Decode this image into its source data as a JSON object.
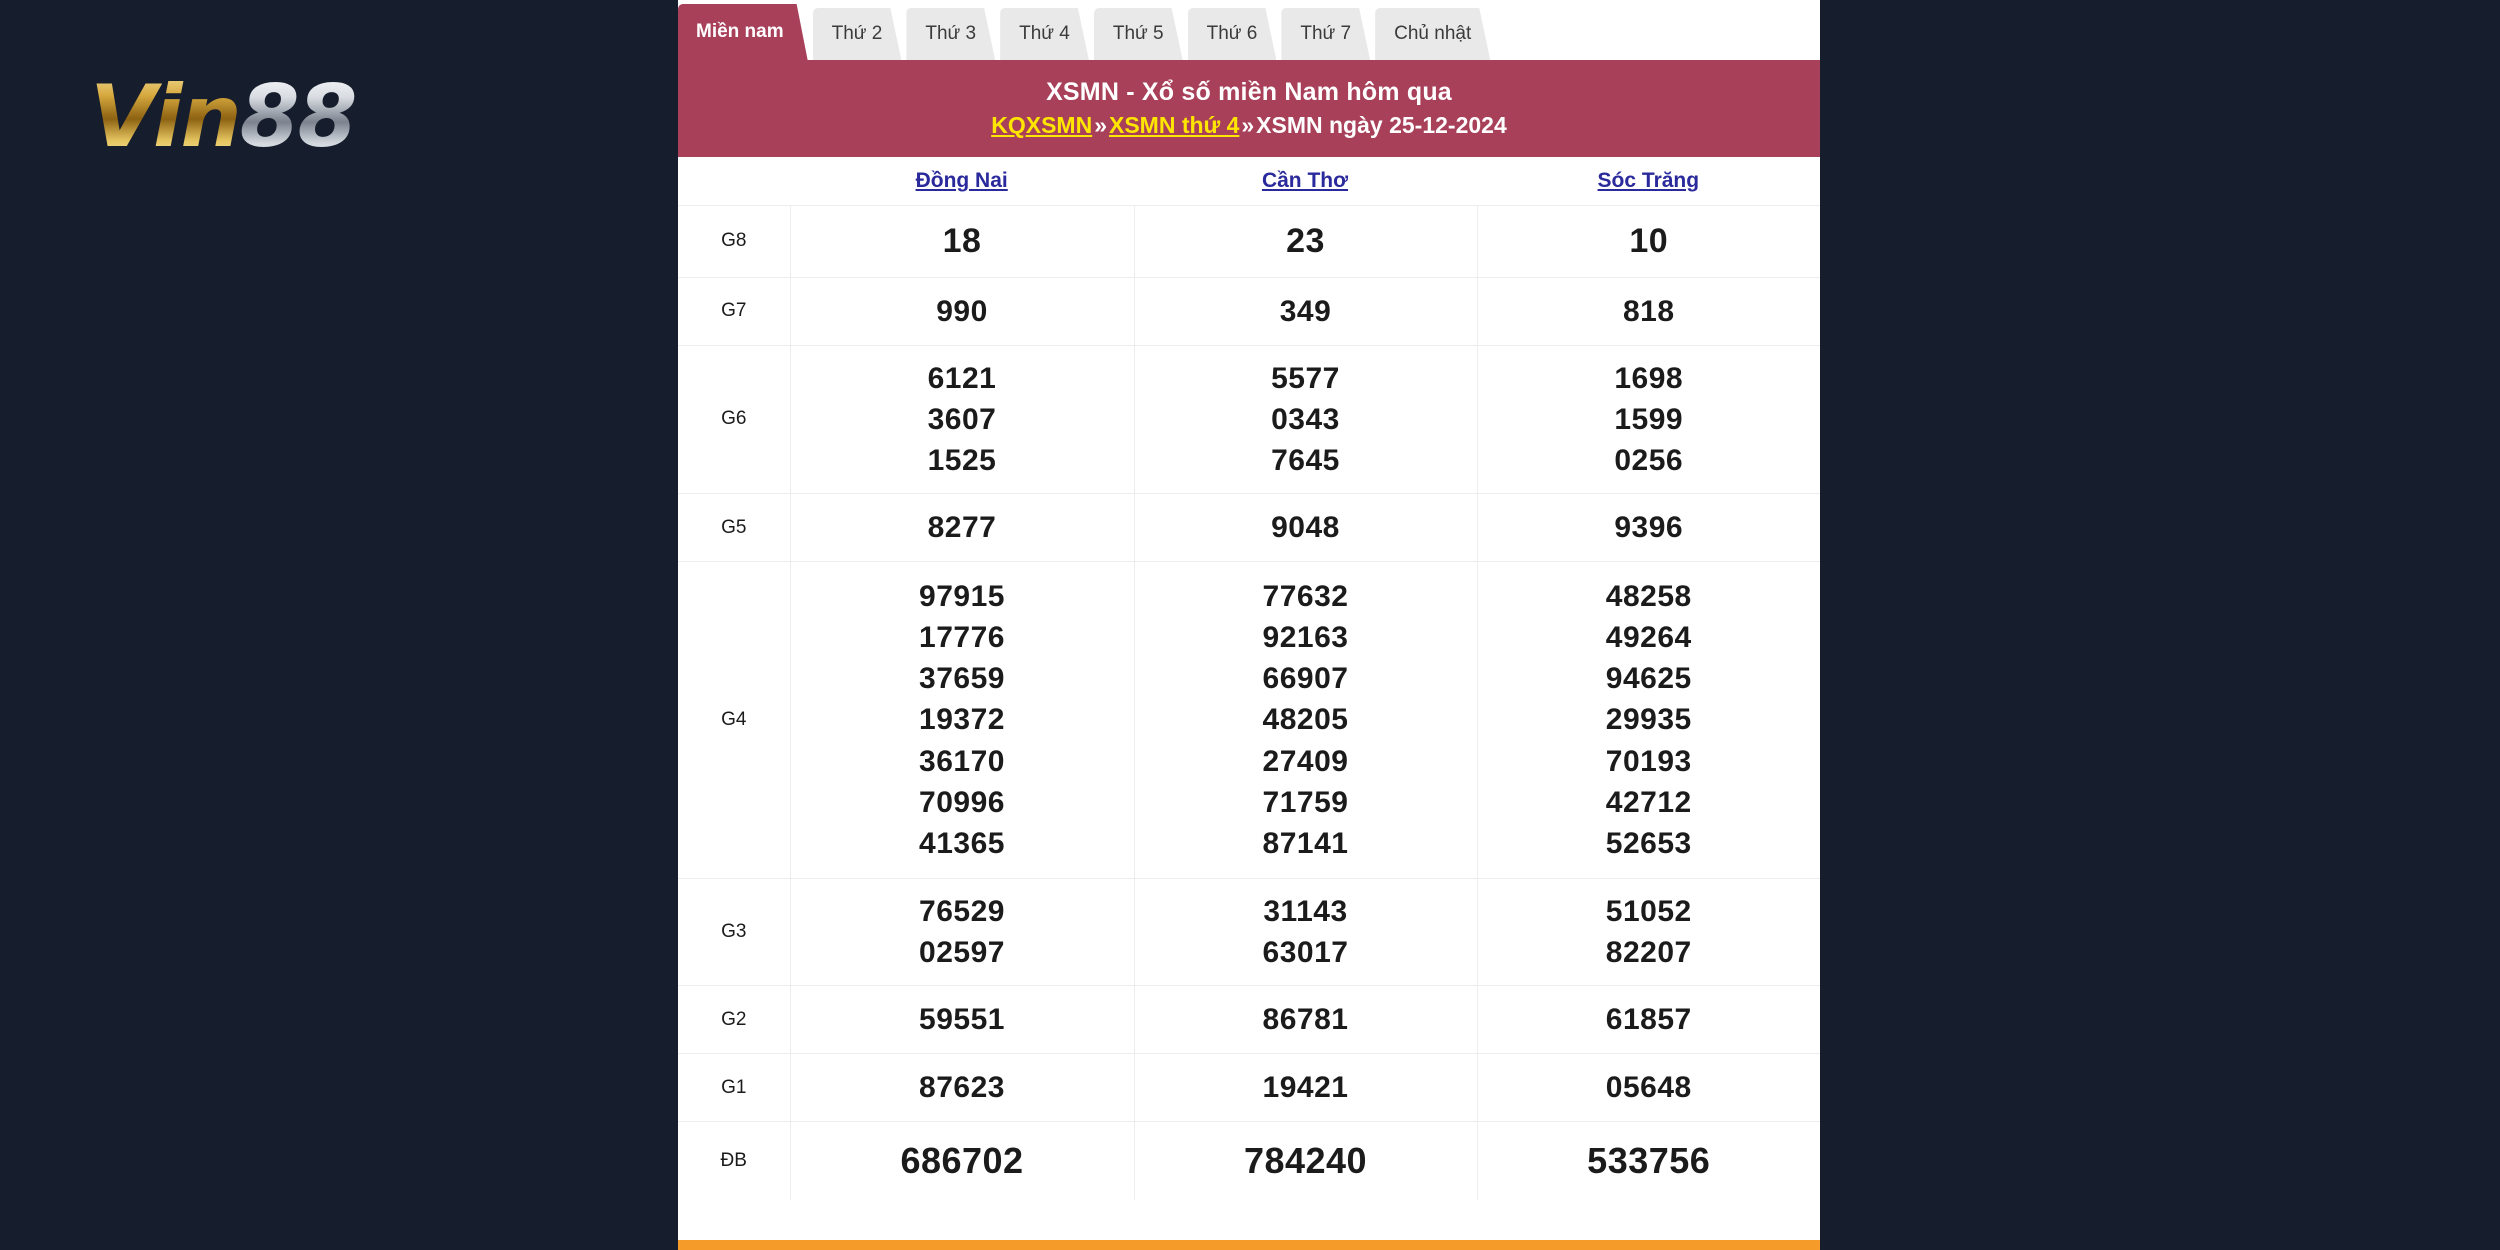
{
  "brand": {
    "name_part1": "Vin",
    "name_part2": "88"
  },
  "tabs": [
    {
      "label": "Miền nam",
      "active": true
    },
    {
      "label": "Thứ 2",
      "active": false
    },
    {
      "label": "Thứ 3",
      "active": false
    },
    {
      "label": "Thứ 4",
      "active": false
    },
    {
      "label": "Thứ 5",
      "active": false
    },
    {
      "label": "Thứ 6",
      "active": false
    },
    {
      "label": "Thứ 7",
      "active": false
    },
    {
      "label": "Chủ nhật",
      "active": false
    }
  ],
  "banner": {
    "title": "XSMN - Xổ số miền Nam hôm qua",
    "crumb1": "KQXSMN",
    "sep1": "»",
    "crumb2": "XSMN thứ 4",
    "sep2": "»",
    "crumb3": "XSMN ngày 25-12-2024"
  },
  "table": {
    "provinces": [
      "Đồng Nai",
      "Cần Thơ",
      "Sóc Trăng"
    ],
    "rows": [
      {
        "label": "G8",
        "style": "g8",
        "values": [
          [
            "18"
          ],
          [
            "23"
          ],
          [
            "10"
          ]
        ]
      },
      {
        "label": "G7",
        "style": "g7",
        "values": [
          [
            "990"
          ],
          [
            "349"
          ],
          [
            "818"
          ]
        ]
      },
      {
        "label": "G6",
        "style": "g6",
        "values": [
          [
            "6121",
            "3607",
            "1525"
          ],
          [
            "5577",
            "0343",
            "7645"
          ],
          [
            "1698",
            "1599",
            "0256"
          ]
        ]
      },
      {
        "label": "G5",
        "style": "g5",
        "values": [
          [
            "8277"
          ],
          [
            "9048"
          ],
          [
            "9396"
          ]
        ]
      },
      {
        "label": "G4",
        "style": "g4",
        "values": [
          [
            "97915",
            "17776",
            "37659",
            "19372",
            "36170",
            "70996",
            "41365"
          ],
          [
            "77632",
            "92163",
            "66907",
            "48205",
            "27409",
            "71759",
            "87141"
          ],
          [
            "48258",
            "49264",
            "94625",
            "29935",
            "70193",
            "42712",
            "52653"
          ]
        ]
      },
      {
        "label": "G3",
        "style": "g3",
        "values": [
          [
            "76529",
            "02597"
          ],
          [
            "31143",
            "63017"
          ],
          [
            "51052",
            "82207"
          ]
        ]
      },
      {
        "label": "G2",
        "style": "g2",
        "values": [
          [
            "59551"
          ],
          [
            "86781"
          ],
          [
            "61857"
          ]
        ]
      },
      {
        "label": "G1",
        "style": "g1",
        "values": [
          [
            "87623"
          ],
          [
            "19421"
          ],
          [
            "05648"
          ]
        ]
      },
      {
        "label": "ĐB",
        "style": "db",
        "values": [
          [
            "686702"
          ],
          [
            "784240"
          ],
          [
            "533756"
          ]
        ]
      }
    ]
  },
  "colors": {
    "page_background": "#161d2c",
    "banner": "#a8405a",
    "accent_red": "#e8170f",
    "link_yellow": "#ffe600",
    "province_link": "#2a2a9c",
    "bottom_bar": "#f59b2a"
  }
}
